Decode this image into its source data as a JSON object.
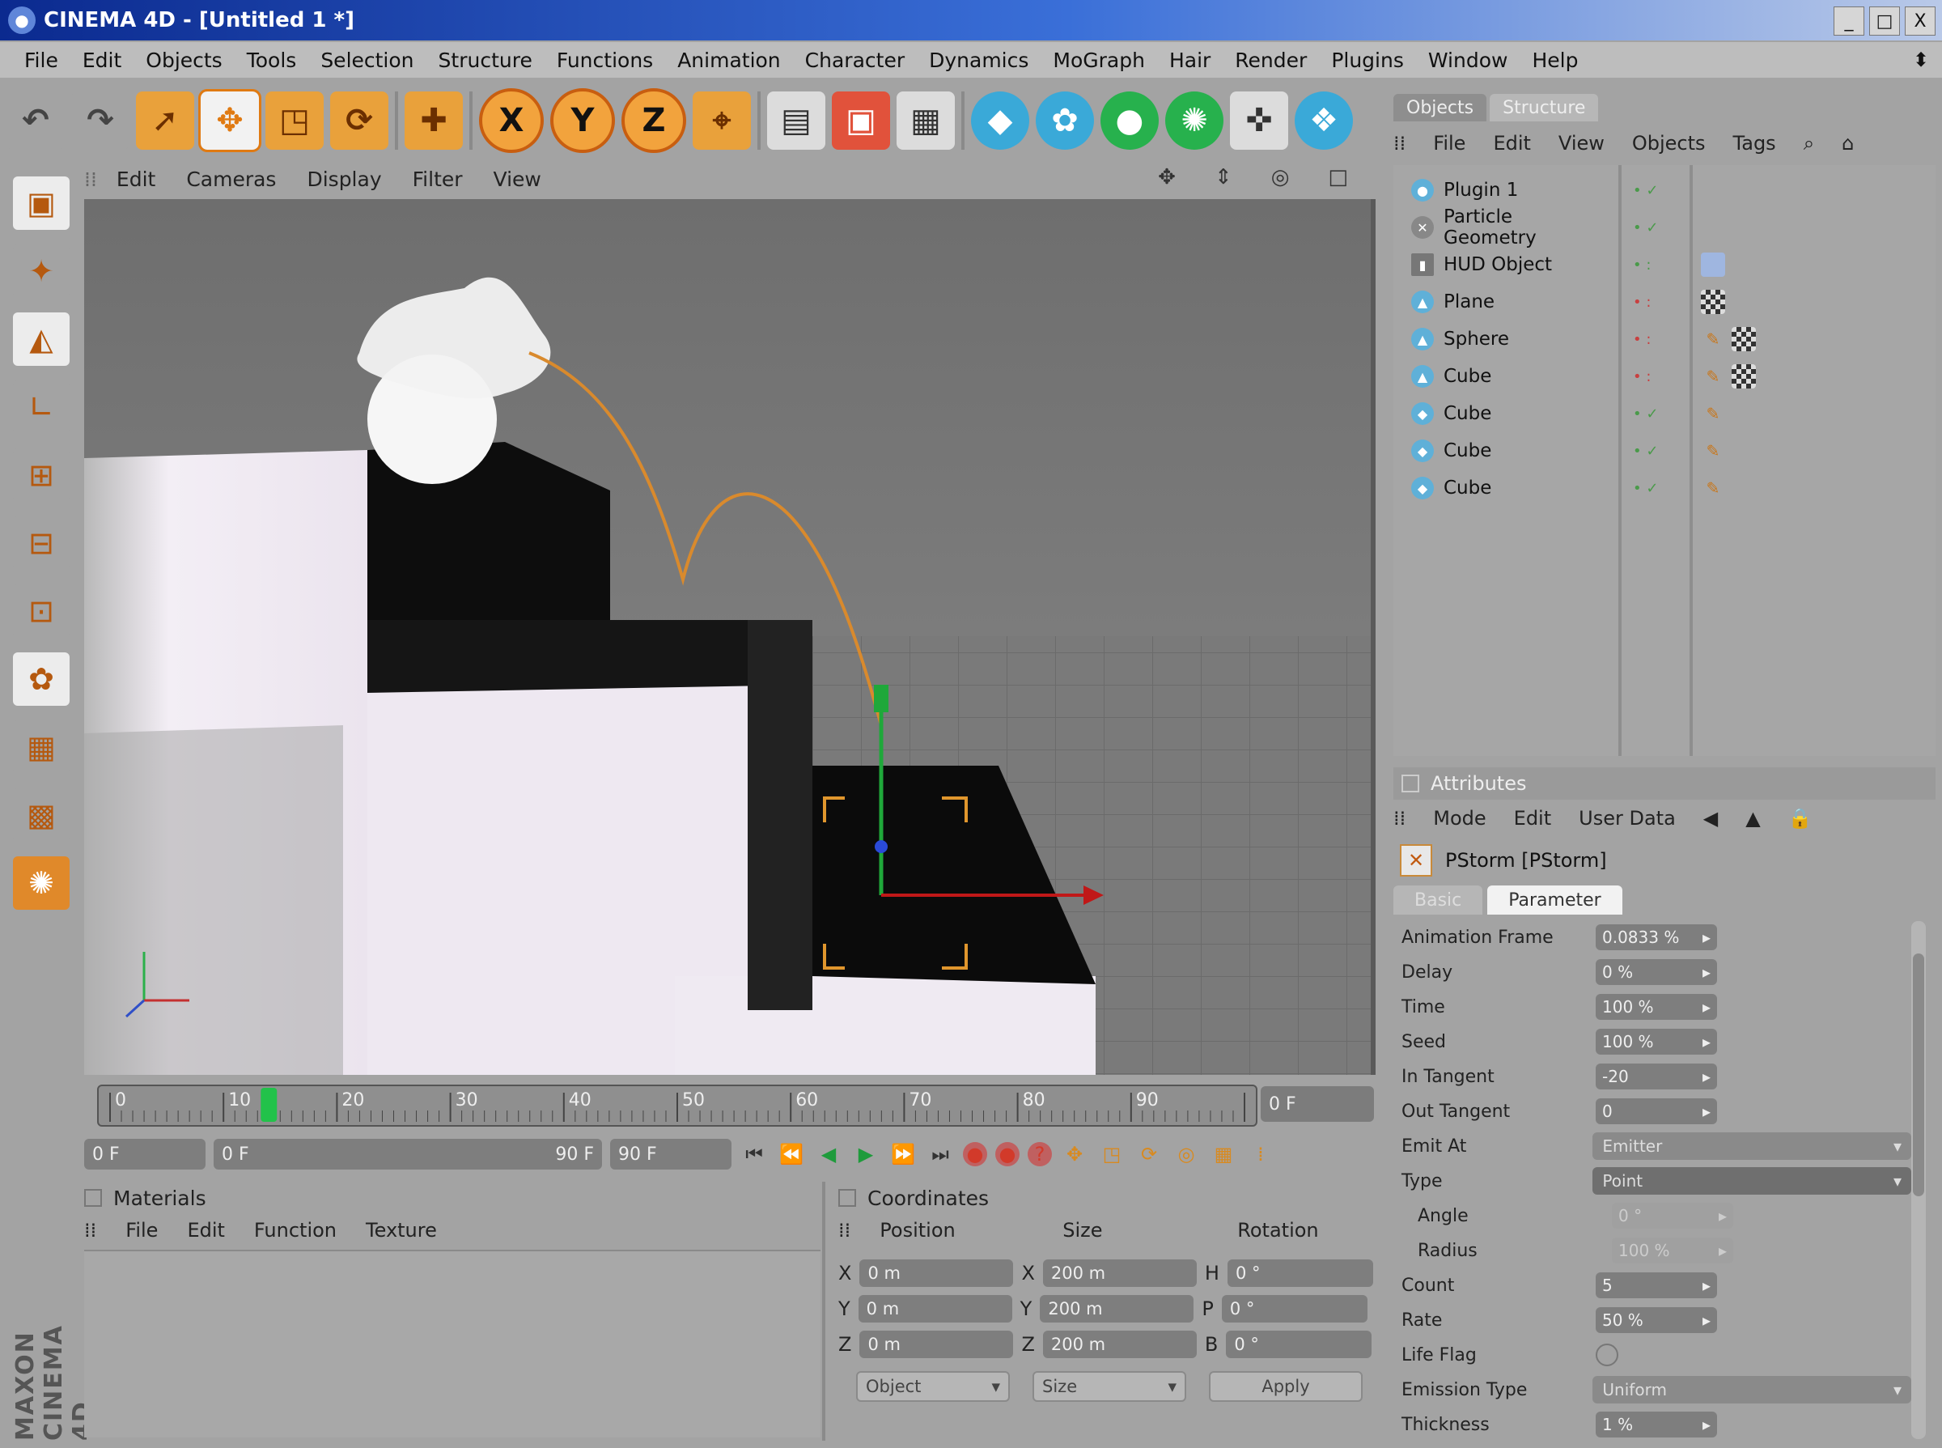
{
  "window": {
    "title": "CINEMA 4D - [Untitled 1 *]",
    "app_icon": "cinema4d-icon",
    "controls": [
      "_",
      "□",
      "X"
    ]
  },
  "menubar": {
    "items": [
      "File",
      "Edit",
      "Objects",
      "Tools",
      "Selection",
      "Structure",
      "Functions",
      "Animation",
      "Character",
      "Dynamics",
      "MoGraph",
      "Hair",
      "Render",
      "Plugins",
      "Window",
      "Help"
    ],
    "right_glyph": "⬍"
  },
  "toolbar": {
    "undo": "↶",
    "redo": "↷",
    "live_select": "➚",
    "move": "✥",
    "scale": "◳",
    "rotate": "⟳",
    "recent": "✚",
    "x_axis": "X",
    "y_axis": "Y",
    "z_axis": "Z",
    "coord_system": "⌖",
    "render_view": "▤",
    "render_picture": "▣",
    "render_settings": "▦",
    "cube": "◆",
    "nurbs": "✿",
    "spline": "●",
    "array": "✺",
    "deformer": "✜",
    "camera": "❖"
  },
  "left_tools": [
    "▣",
    "✦",
    "◭",
    "∟",
    "⊞",
    "⊟",
    "⊡",
    "✿",
    "▦",
    "▩",
    "✺"
  ],
  "branding": "MAXON CINEMA 4D",
  "viewport": {
    "menu": [
      "Edit",
      "Cameras",
      "Display",
      "Filter",
      "View"
    ],
    "nav_icons": [
      "✥",
      "⇕",
      "◎",
      "□"
    ]
  },
  "timeline": {
    "ticks": [
      "0",
      "10",
      "20",
      "30",
      "40",
      "50",
      "60",
      "70",
      "80",
      "90"
    ],
    "current_frame": 14,
    "end_frame": "0 F"
  },
  "playback": {
    "start_field": "0 F",
    "range_start": "0 F",
    "range_end": "90 F",
    "end_field": "90 F"
  },
  "mograph_panel": {
    "title": "Materials",
    "menu": [
      "File",
      "Edit",
      "Function",
      "Texture"
    ]
  },
  "coordinates": {
    "title": "Coordinates",
    "headers": [
      "Position",
      "Size",
      "Rotation"
    ],
    "rows": [
      {
        "axis": "X",
        "pos": "0 m",
        "size_axis": "X",
        "size": "200 m",
        "rot_axis": "H",
        "rot": "0 °"
      },
      {
        "axis": "Y",
        "pos": "0 m",
        "size_axis": "Y",
        "size": "200 m",
        "rot_axis": "P",
        "rot": "0 °"
      },
      {
        "axis": "Z",
        "pos": "0 m",
        "size_axis": "Z",
        "size": "200 m",
        "rot_axis": "B",
        "rot": "0 °"
      }
    ],
    "object_mode": "Object",
    "size_mode": "Size",
    "apply": "Apply"
  },
  "object_manager": {
    "tabs": [
      "Objects",
      "Structure"
    ],
    "menu": [
      "File",
      "Edit",
      "View",
      "Objects",
      "Tags"
    ],
    "objects": [
      {
        "name": "Plugin 1",
        "icon": "emitter-icon",
        "tags": []
      },
      {
        "name": "Particle Geometry",
        "icon": "particle-icon",
        "tags": []
      },
      {
        "name": "HUD Object",
        "icon": "null-icon",
        "tags": [
          "blue"
        ]
      },
      {
        "name": "Plane",
        "icon": "plane-icon",
        "tags": [
          "check"
        ]
      },
      {
        "name": "Sphere",
        "icon": "sphere-icon",
        "tags": [
          "phong",
          "check"
        ]
      },
      {
        "name": "Cube",
        "icon": "cube-icon",
        "tags": [
          "phong",
          "check"
        ]
      },
      {
        "name": "Cube",
        "icon": "cube-icon",
        "tags": [
          "phong"
        ]
      },
      {
        "name": "Cube",
        "icon": "cube-icon",
        "tags": [
          "phong"
        ]
      },
      {
        "name": "Cube",
        "icon": "cube-icon",
        "tags": [
          "phong"
        ]
      }
    ]
  },
  "attributes": {
    "title": "Attributes",
    "menu": [
      "Mode",
      "Edit",
      "User Data"
    ],
    "object_label": "PStorm [PStorm]",
    "tabs": [
      "Basic",
      "Parameter"
    ],
    "params": [
      {
        "label": "Animation Frame",
        "value": "0.0833 %"
      },
      {
        "label": "Delay",
        "value": "0 %"
      },
      {
        "label": "Time",
        "value": "100 %"
      },
      {
        "label": "Seed",
        "value": "100 %"
      },
      {
        "label": "In Tangent",
        "value": "-20"
      },
      {
        "label": "Out Tangent",
        "value": "0"
      },
      {
        "label": "Emit At",
        "dropdown": "Emitter"
      },
      {
        "label": "Type",
        "dropdown": "Point"
      },
      {
        "label": "Angle",
        "value": "0 °"
      },
      {
        "label": "Radius",
        "value": "100 %"
      },
      {
        "label": "Count",
        "value": "5"
      },
      {
        "label": "Rate",
        "value": "50 %"
      },
      {
        "label": "Life Flag",
        "radio": true
      },
      {
        "label": "Emission Type",
        "dropdown": "Uniform"
      },
      {
        "label": "Thickness",
        "value": "1 %"
      }
    ]
  }
}
